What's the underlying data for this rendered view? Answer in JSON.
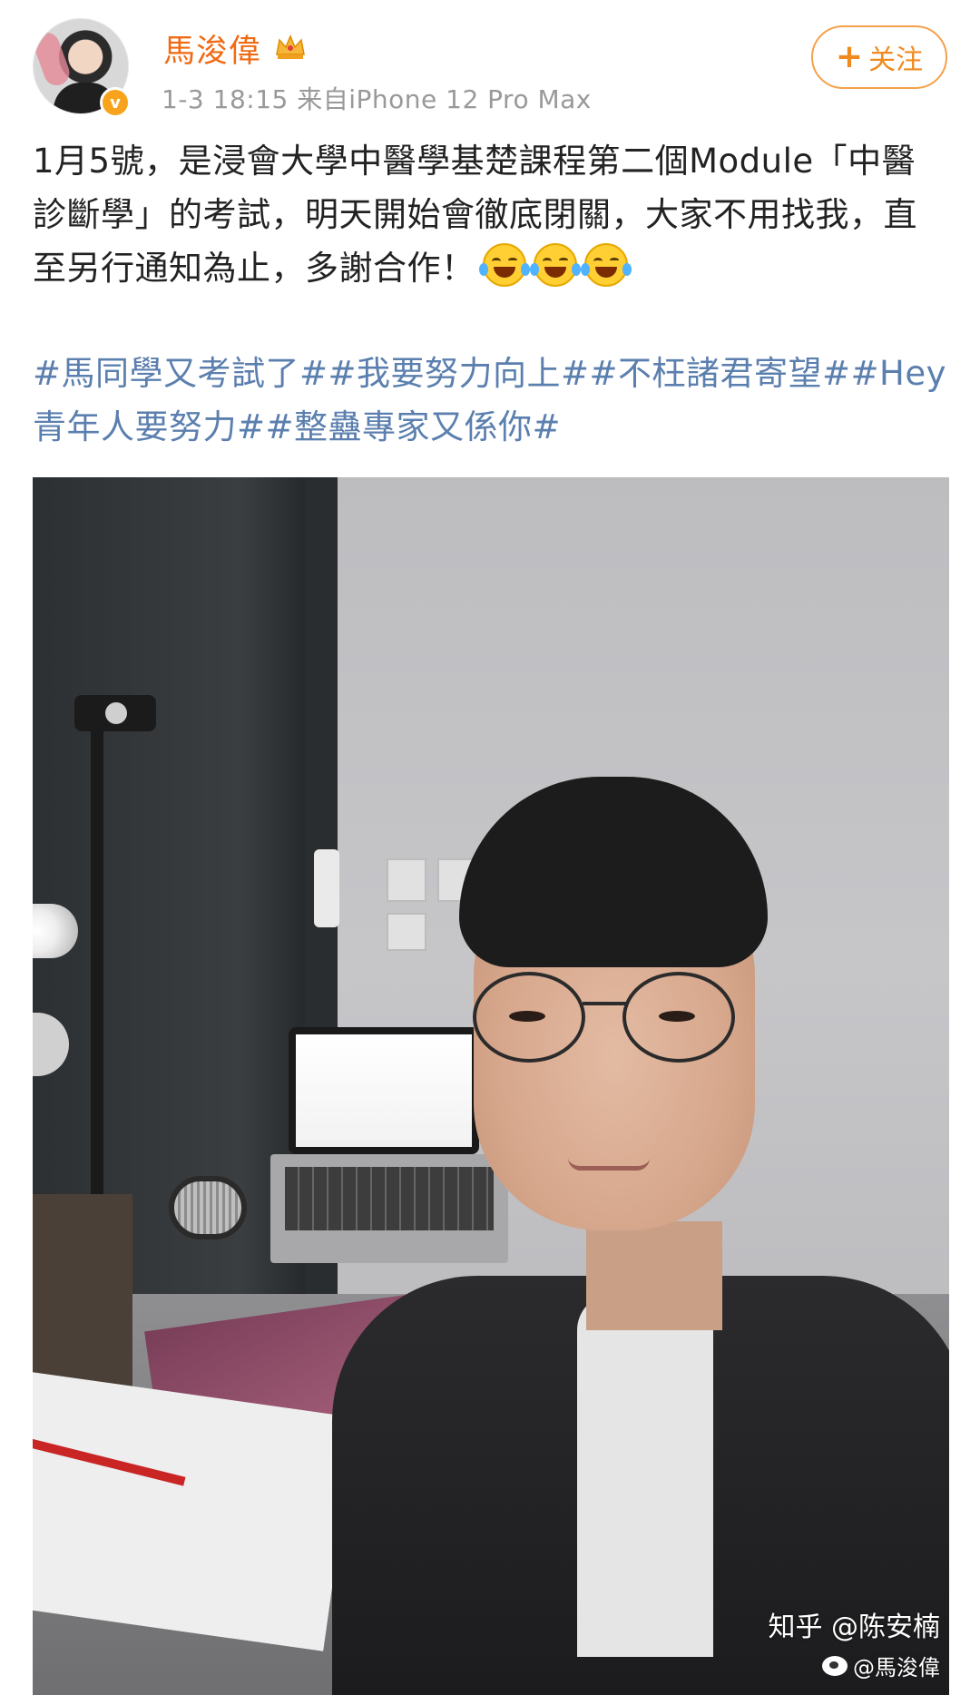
{
  "user": {
    "name": "馬浚偉",
    "meta": "1-3 18:15  来自iPhone 12 Pro Max",
    "verified_symbol": "v"
  },
  "follow_button": {
    "plus": "+",
    "label": "关注"
  },
  "post": {
    "text": "1月5號，是浸會大學中醫學基楚課程第二個Module「中醫診斷學」的考試，明天開始會徹底閉關，大家不用找我，直至另行通知為止，多謝合作！",
    "emojis": [
      "laugh-cry",
      "laugh-cry",
      "laugh-cry"
    ]
  },
  "hashtags": "#馬同學又考試了##我要努力向上##不枉諸君寄望##Hey 青年人要努力##整蠱專家又係你#",
  "watermark": {
    "zhihu": "知乎 @陈安楠",
    "weibo": "@馬浚偉"
  },
  "colors": {
    "name": "#f06a12",
    "hashtag": "#5b7fae",
    "meta": "#999999",
    "follow_border": "#f6a04a"
  }
}
